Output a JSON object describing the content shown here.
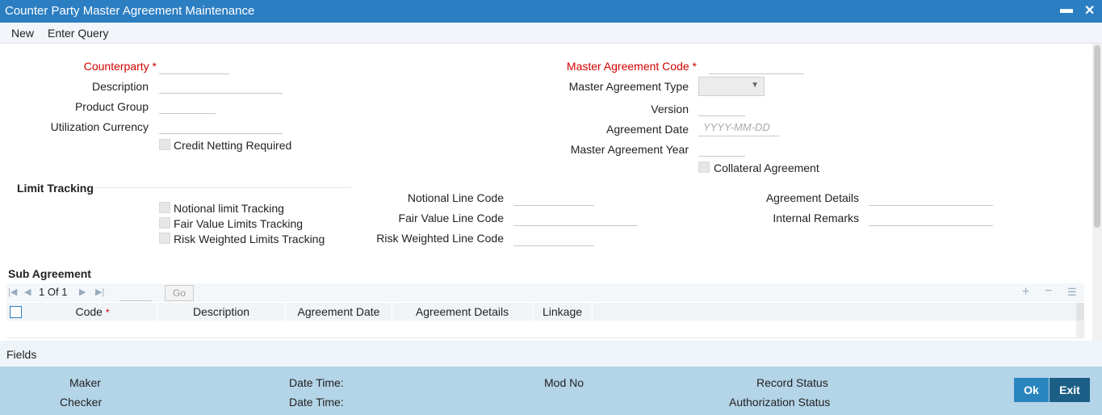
{
  "window": {
    "title": "Counter Party Master Agreement Maintenance",
    "minimize_glyph": "▬",
    "close_glyph": "✕"
  },
  "menu": {
    "new": "New",
    "enter_query": "Enter Query"
  },
  "form": {
    "counterparty_label": "Counterparty",
    "description_label": "Description",
    "product_group_label": "Product Group",
    "utilization_currency_label": "Utilization Currency",
    "credit_netting_label": "Credit Netting Required",
    "master_agreement_code_label": "Master Agreement Code",
    "master_agreement_type_label": "Master Agreement Type",
    "version_label": "Version",
    "agreement_date_label": "Agreement Date",
    "agreement_date_placeholder": "YYYY-MM-DD",
    "master_agreement_year_label": "Master Agreement Year",
    "collateral_agreement_label": "Collateral Agreement",
    "required_mark": "*"
  },
  "limit_tracking": {
    "title": "Limit Tracking",
    "notional_tracking": "Notional limit Tracking",
    "fair_value_tracking": "Fair Value Limits Tracking",
    "risk_weighted_tracking": "Risk Weighted Limits Tracking",
    "notional_line_code": "Notional Line Code",
    "fair_value_line_code": "Fair Value Line Code",
    "risk_weighted_line_code": "Risk Weighted Line Code",
    "agreement_details": "Agreement Details",
    "internal_remarks": "Internal Remarks"
  },
  "sub_agreement": {
    "title": "Sub Agreement",
    "page_current": "1",
    "page_of": "Of",
    "page_total": "1",
    "go": "Go",
    "columns": [
      "Code",
      "Description",
      "Agreement Date",
      "Agreement Details",
      "Linkage"
    ],
    "required_mark": "*"
  },
  "fields_bar": {
    "label": "Fields"
  },
  "footer": {
    "maker": "Maker",
    "checker": "Checker",
    "date_time_1": "Date Time:",
    "date_time_2": "Date Time:",
    "mod_no": "Mod No",
    "record_status": "Record Status",
    "authorization_status": "Authorization Status",
    "ok": "Ok",
    "exit": "Exit"
  },
  "colors": {
    "title_bar": "#2c7ec2",
    "required": "#d40000",
    "footer": "#b4d4e7",
    "ok_button": "#2a85bf",
    "exit_button": "#1c5f86"
  },
  "icons": [
    "minimize-icon",
    "close-icon",
    "first-page-icon",
    "prev-page-icon",
    "next-page-icon",
    "last-page-icon",
    "add-row-icon",
    "delete-row-icon",
    "single-view-icon",
    "dropdown-caret-icon"
  ]
}
